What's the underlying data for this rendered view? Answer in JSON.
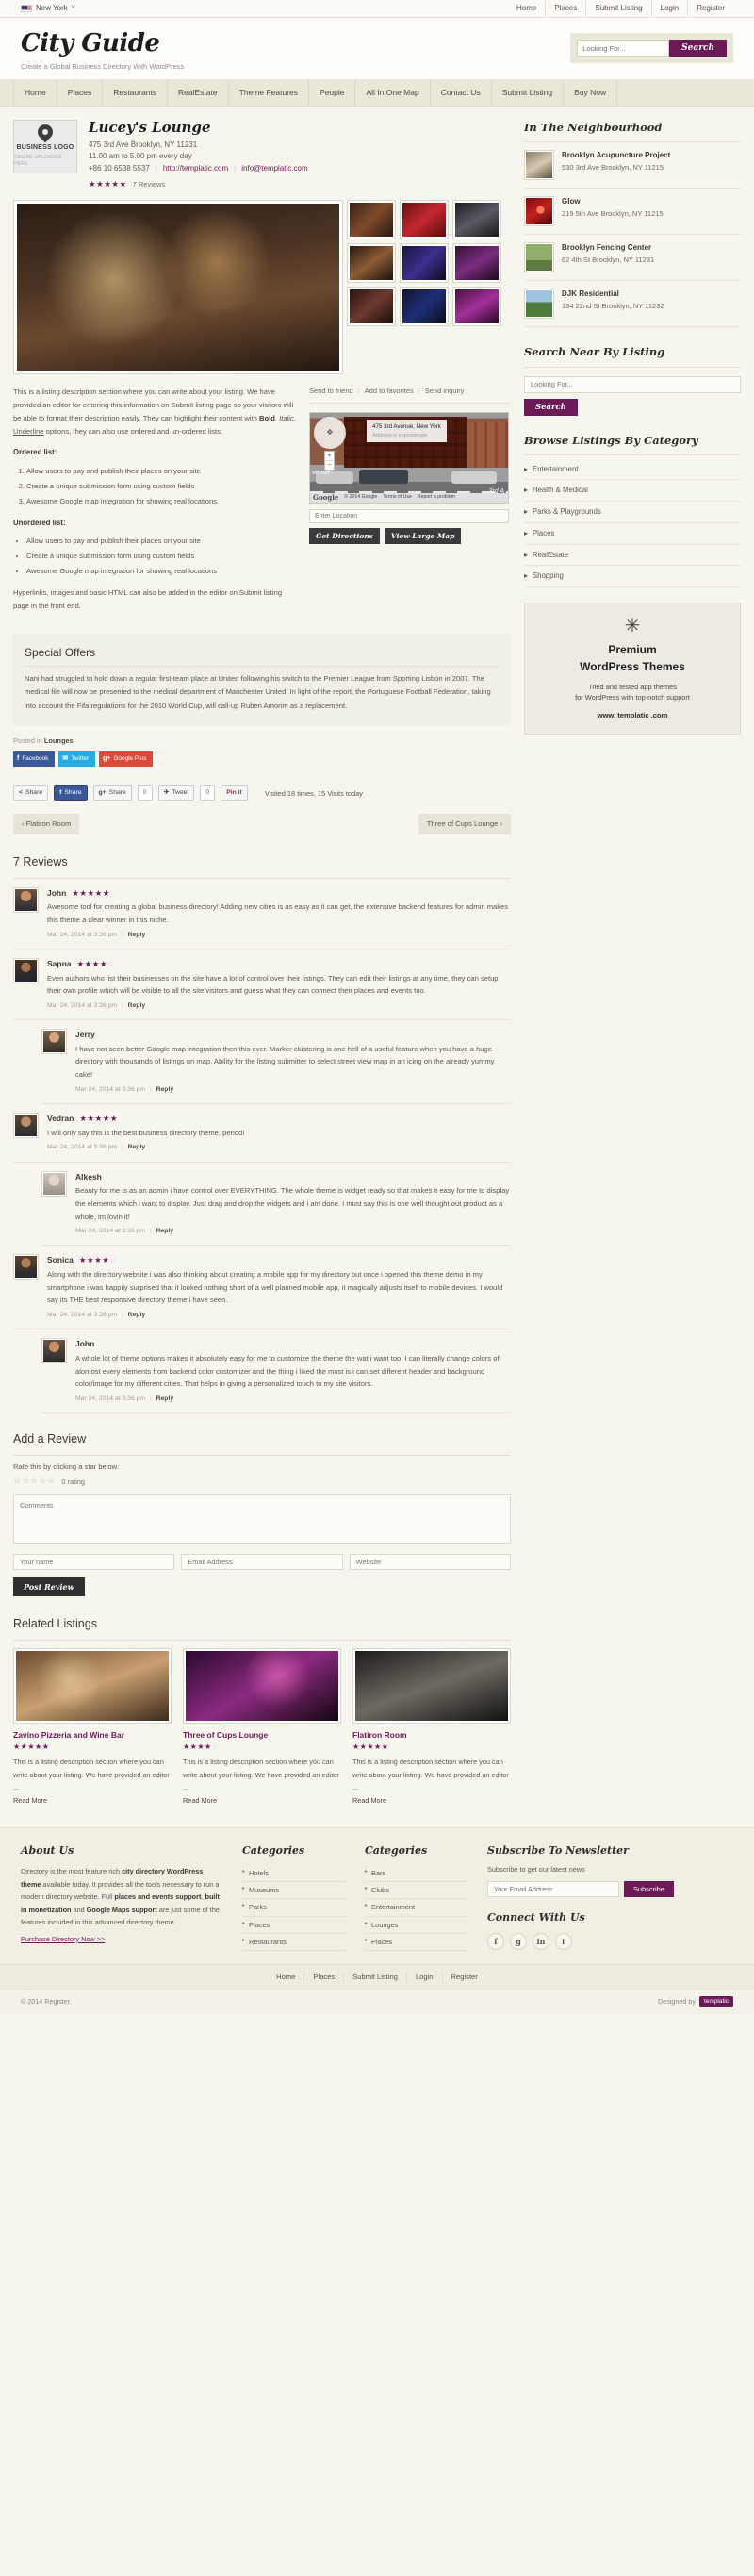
{
  "topbar": {
    "city": "New York",
    "caret": "˅",
    "nav": [
      "Home",
      "Places",
      "Submit Listing",
      "Login",
      "Register"
    ]
  },
  "header": {
    "logo": "City Guide",
    "tagline": "Create a Global Business Directory With WordPress",
    "search_placeholder": "Looking For...",
    "search_button": "Search"
  },
  "mainnav": [
    "Home",
    "Places",
    "Restaurants",
    "RealEstate",
    "Theme Features",
    "People",
    "All In One Map",
    "Contact Us",
    "Submit Listing",
    "Buy Now"
  ],
  "listing": {
    "logo_line1": "BUSINESS LOGO",
    "logo_line2": "CAN BE UPLOADED HERE",
    "title": "Lucey's Lounge",
    "address": "475 3rd Ave Brooklyn, NY 11231",
    "hours": "11.00 am to 5.00 pm every day",
    "phone": "+86 10 6538 5537",
    "website": "http://templatic.com",
    "email": "info@templatic.com",
    "stars": 5,
    "reviews_count": "7 Reviews"
  },
  "description": {
    "p1_a": "This is a listing description section where you can write about your listing. We have provided an editor for entering this information on Submit listing page so your visitors will be able to format their description easily. They can highlight their content with ",
    "bold": "Bold",
    "italic": "Italic",
    "underline": "Underline",
    "p1_b": " options, they can also use ordered and un-ordered lists:",
    "ordered_title": "Ordered list:",
    "ordered": [
      "Allow users to pay and publish their places on your site",
      "Create a unique submission form using custom fields",
      "Awesome Google map integration for showing real locations"
    ],
    "unordered_title": "Unordered list:",
    "unordered": [
      "Allow users to pay and publish their places on your site",
      "Create a unique submission form using custom fields",
      "Awesome Google map integration for showing real locations"
    ],
    "p2": "Hyperlinks, images and basic HTML can also be added in the editor on Submit listing page in the front end."
  },
  "map": {
    "actions": [
      "Send to friend",
      "Add to favorites",
      "Send inquiry"
    ],
    "info_title": "475 3rd Avenue, New York",
    "info_sub": "Address is approximate",
    "google_logo": "Google",
    "copyright": "© 2014 Google",
    "terms": "Terms of Use",
    "report": "Report a problem",
    "street_label": "venue",
    "street_label2": "3rd A",
    "location_placeholder": "Enter Location",
    "btn_directions": "Get Directions",
    "btn_large_map": "View Large Map",
    "zoom_in": "+",
    "zoom_out": "−"
  },
  "offers": {
    "title": "Special Offers",
    "body": "Nani had struggled to hold down a regular first-team place at United following his switch to the Premier League from Sporting Lisbon in 2007. The medical file will now be presented to the medical department of Manchester United. In light of the report, the Portuguese Football Federation, taking into account the Fifa regulations for the 2010 World Cup, will call-up Ruben Amorim as a replacement."
  },
  "posted": {
    "prefix": "Posted in",
    "category": "Lounges"
  },
  "social_buttons": [
    {
      "label": "Facebook",
      "glyph": "f",
      "cls": "sb-fb"
    },
    {
      "label": "Twitter",
      "glyph": "✉",
      "cls": "sb-tw"
    },
    {
      "label": "Google Plus",
      "glyph": "g+",
      "cls": "sb-gp"
    }
  ],
  "share": {
    "share1": "Share",
    "share2": "Share",
    "share3": "Share",
    "count1": "0",
    "tweet": "Tweet",
    "count2": "0",
    "pinit": "Pin it",
    "visits": "Visited 18 times, 15 Visits today"
  },
  "pager": {
    "prev": "‹ Flatiron Room",
    "next": "Three of Cups Lounge ›"
  },
  "reviews": {
    "title": "7 Reviews",
    "items": [
      {
        "name": "John",
        "stars": 5,
        "nested": false,
        "avatar": "av1",
        "text": "Awesome tool for creating a global business directory! Adding new cities is as easy as it can get, the extensive backend features for admin makes this theme a clear winner in this niche.",
        "date": "Mar 24, 2014 at 3:36 pm",
        "reply": "Reply"
      },
      {
        "name": "Sapna",
        "stars": 4,
        "nested": false,
        "avatar": "av2",
        "text": "Even authors who list their businesses on the site have a lot of control over their listings. They can edit their listings at any time, they can setup their own profile which will be visible to all the site visitors and guess what they can connect their places and events too.",
        "date": "Mar 24, 2014 at 3:36 pm",
        "reply": "Reply"
      },
      {
        "name": "Jerry",
        "stars": 0,
        "nested": true,
        "avatar": "av3",
        "text": "I have not seen better Google map integration then this ever. Marker clustering is one hell of a useful feature when you have a huge directory with thousands of listings on map. Ability for the listing submitter to select street view map in an icing on the already yummy cake!",
        "date": "Mar 24, 2014 at 3:36 pm",
        "reply": "Reply"
      },
      {
        "name": "Vedran",
        "stars": 5,
        "nested": false,
        "avatar": "av4",
        "text": "I will only say this is the best business directory theme, period!",
        "date": "Mar 24, 2014 at 3:36 pm",
        "reply": "Reply"
      },
      {
        "name": "Alkesh",
        "stars": 0,
        "nested": true,
        "avatar": "av5",
        "text": "Beauty for me is as an admin i have control over EVERYTHING. The whole theme is widget ready so that makes it easy for me to display the elements which i want to display. Just drag and drop the widgets and i am done. I must say this is one well thought out product as a whole, im lovin it!",
        "date": "Mar 24, 2014 at 3:36 pm",
        "reply": "Reply"
      },
      {
        "name": "Sonica",
        "stars": 4,
        "nested": false,
        "avatar": "av6",
        "text": "Along with the directory website i was also thinking about creating a mobile app for my directory but once i opened this theme demo in my smartphone i was happily surprised that it looked nothing short of a well planned mobile app, it magically adjusts itself to mobile devices. I would say its THE best responsive directory theme i have seen.",
        "date": "Mar 24, 2014 at 3:36 pm",
        "reply": "Reply"
      },
      {
        "name": "John",
        "stars": 0,
        "nested": true,
        "avatar": "av7",
        "text": "A whole lot of theme options makes it absolutely easy for me to customize the theme the wat i want too. I can literally change colors of alomost every elements from backend color customizer and the thing i liked the most is i can set different header and background color/image for my different cities. That helps in giving a personalized touch to my site visitors.",
        "date": "Mar 24, 2014 at 3:36 pm",
        "reply": "Reply"
      }
    ]
  },
  "add_review": {
    "title": "Add a Review",
    "rate_label": "Rate this by clicking a star below:",
    "stars_empty": "☆☆☆☆☆",
    "rating_text": "0 rating",
    "comments_placeholder": "Comments",
    "name_placeholder": "Your name",
    "email_placeholder": "Email Address",
    "website_placeholder": "Website",
    "post_button": "Post Review"
  },
  "related": {
    "title": "Related Listings",
    "cards": [
      {
        "title": "Zavino Pizzeria and Wine Bar",
        "stars": 5,
        "img": "ri1",
        "desc": "This is a listing description section where you can write about your listing. We have provided an editor ...",
        "more": "Read More"
      },
      {
        "title": "Three of Cups Lounge",
        "stars": 4,
        "img": "ri2",
        "desc": "This is a listing description section where you can write about your listing. We have provided an editor ...",
        "more": "Read More"
      },
      {
        "title": "Flatiron Room",
        "stars": 5,
        "img": "ri3",
        "desc": "This is a listing description section where you can write about your listing. We have provided an editor ...",
        "more": "Read More"
      }
    ]
  },
  "sidebar": {
    "neighbourhood_title": "In The Neighbourhood",
    "neighbourhood": [
      {
        "name": "Brooklyn Acupuncture Project",
        "addr": "530 3rd Ave Brooklyn, NY 11215",
        "thumb": "n1"
      },
      {
        "name": "Glow",
        "addr": "219 5th Ave Brooklyn, NY 11215",
        "thumb": "n2"
      },
      {
        "name": "Brooklyn Fencing Center",
        "addr": "62 4th St Brooklyn, NY 11231",
        "thumb": "n3"
      },
      {
        "name": "DJK Residential",
        "addr": "134 22nd St Brooklyn, NY 11232",
        "thumb": "n4"
      }
    ],
    "search_title": "Search Near By Listing",
    "search_placeholder": "Looking For...",
    "search_button": "Search",
    "browse_title": "Browse Listings By Category",
    "categories": [
      "Entertainment",
      "Health & Medical",
      "Parks & Playgrounds",
      "Places",
      "RealEstate",
      "Shopping"
    ],
    "ad": {
      "line1": "Premium",
      "line2": "WordPress Themes",
      "line3": "Tried and tested app themes",
      "line4": "for WordPress with top-notch support",
      "url": "www. templatic .com"
    }
  },
  "footer": {
    "about_title": "About Us",
    "about_a": "Directory is the most feature rich ",
    "about_b1": "city directory WordPress theme",
    "about_c": " available today. It provides all the tools necessary to run a modern directory website. Full ",
    "about_b2": "places and events support",
    "about_d": ", ",
    "about_b3": "built in monetization",
    "about_e": " and ",
    "about_b4": "Google Maps support",
    "about_f": " are just some of the features included in this advanced directory theme.",
    "about_link": "Purchase Directory Now >>",
    "cat1_title": "Categories",
    "cat1": [
      "Hotels",
      "Museums",
      "Parks",
      "Places",
      "Restaurants"
    ],
    "cat2_title": "Categories",
    "cat2": [
      "Bars",
      "Clubs",
      "Entertainment",
      "Lounges",
      "Places"
    ],
    "news_title": "Subscribe To Newsletter",
    "news_text": "Subscribe to get our latest news",
    "news_placeholder": "Your Email Address",
    "news_button": "Subscribe",
    "connect_title": "Connect With Us",
    "social": [
      "f",
      "g",
      "in",
      "t"
    ],
    "botnav": [
      "Home",
      "Places",
      "Submit Listing",
      "Login",
      "Register"
    ],
    "copyright": "© 2014 Register.",
    "designed_by": "Designed by",
    "brand": "templatic"
  }
}
